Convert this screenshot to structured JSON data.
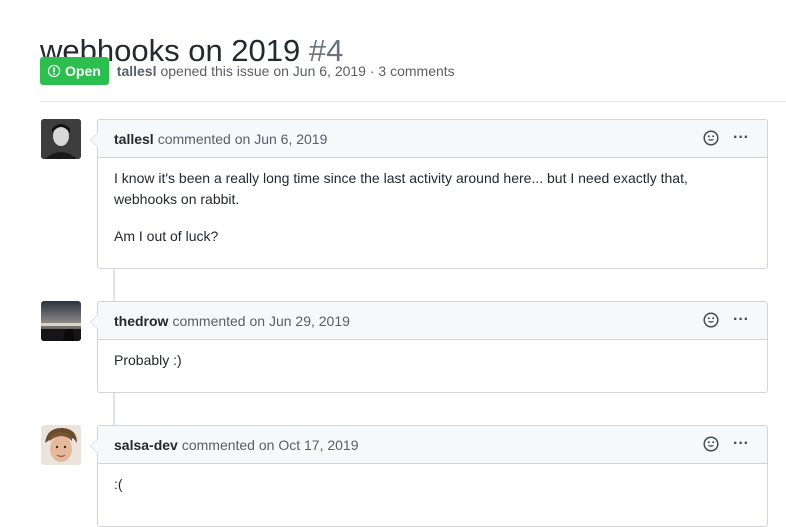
{
  "issue": {
    "title": "webhooks on 2019",
    "number": "#4",
    "status": "Open",
    "author": "tallesl",
    "meta_text": "opened this issue on Jun 6, 2019 · 3 comments"
  },
  "comments": [
    {
      "user": "tallesl",
      "date_text": "commented on Jun 6, 2019",
      "paragraphs": [
        "I know it's been a really long time since the last activity around here... but I need exactly that, webhooks on rabbit.",
        "Am I out of luck?"
      ]
    },
    {
      "user": "thedrow",
      "date_text": "commented on Jun 29, 2019",
      "paragraphs": [
        "Probably :)"
      ]
    },
    {
      "user": "salsa-dev",
      "date_text": "commented on Oct 17, 2019",
      "paragraphs": [
        ":("
      ]
    }
  ],
  "icons": {
    "status": "issue-opened-icon",
    "reaction": "smiley-icon",
    "more": "kebab-horizontal-icon"
  },
  "colors": {
    "open_badge": "#2cbe4e",
    "border": "#d1d5da",
    "header_bg": "#f6f8fa",
    "muted_text": "#586069"
  }
}
